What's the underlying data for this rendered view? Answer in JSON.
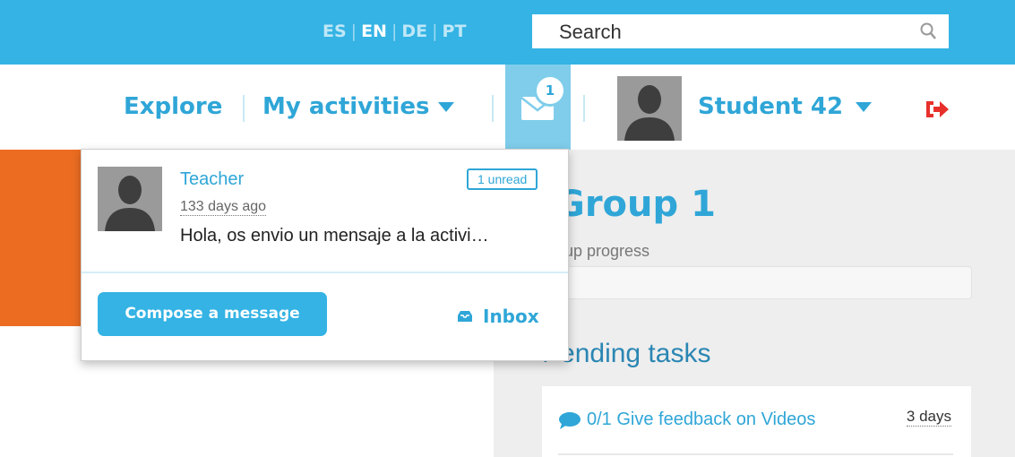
{
  "header": {
    "languages": [
      {
        "code": "ES",
        "active": false
      },
      {
        "code": "EN",
        "active": true
      },
      {
        "code": "DE",
        "active": false
      },
      {
        "code": "PT",
        "active": false
      }
    ],
    "search_placeholder": "Search",
    "accent_color": "#34b3e4"
  },
  "nav": {
    "explore": "Explore",
    "my_activities": "My activities",
    "messages_badge": "1",
    "user_name": "Student 42",
    "icons": [
      "envelope-icon",
      "avatar",
      "logout-icon"
    ]
  },
  "messages_dropdown": {
    "sender": "Teacher",
    "time": "133 days ago",
    "preview": "Hola, os envio un mensaje a la activi…",
    "unread_label": "1 unread",
    "compose_label": "Compose a message",
    "inbox_label": "Inbox"
  },
  "group": {
    "title": "Group 1",
    "progress_label": "Group progress",
    "pending_title": "Pending tasks",
    "task": {
      "label": "0/1 Give feedback on Videos",
      "due": "3 days"
    }
  },
  "colors": {
    "orange_block": "#ec6d22",
    "logout": "#e8302b"
  }
}
